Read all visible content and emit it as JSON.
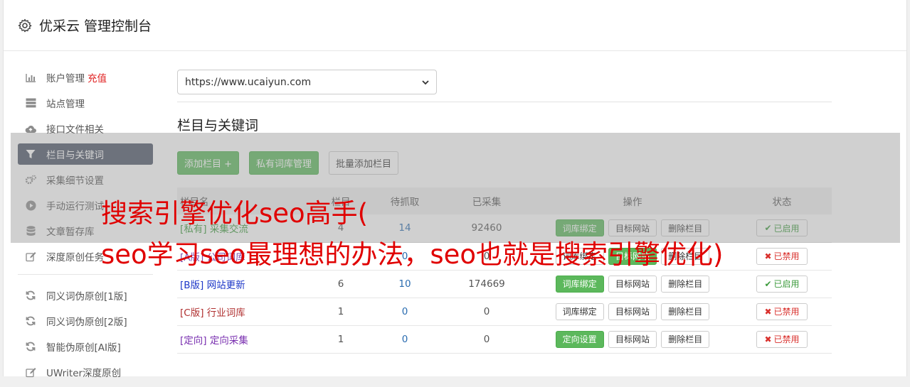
{
  "header": {
    "title": "优采云 管理控制台",
    "icon": "gear-icon"
  },
  "sidebar": {
    "items": [
      {
        "label": "账户管理",
        "extra": "充值",
        "icon": "bar-chart-icon"
      },
      {
        "label": "站点管理",
        "icon": "server-icon"
      },
      {
        "label": "接口文件相关",
        "icon": "cloud-upload-icon"
      },
      {
        "label": "栏目与关键词",
        "icon": "filter-icon",
        "active": true
      },
      {
        "label": "采集细节设置",
        "icon": "cogs-icon"
      },
      {
        "label": "手动运行测试",
        "icon": "play-circle-icon"
      },
      {
        "label": "文章暂存库",
        "icon": "database-icon"
      },
      {
        "label": "深度原创任务",
        "icon": "edit-icon"
      }
    ],
    "items2": [
      {
        "label": "同义词伪原创[1版]",
        "icon": "refresh-icon"
      },
      {
        "label": "同义词伪原创[2版]",
        "icon": "refresh-icon"
      },
      {
        "label": "智能伪原创[AI版]",
        "icon": "refresh-icon"
      },
      {
        "label": "UWriter深度原创",
        "icon": "edit-icon"
      }
    ]
  },
  "site_select": {
    "value": "https://www.ucaiyun.com"
  },
  "section": {
    "title": "栏目与关键词"
  },
  "buttons": {
    "add_column": "添加栏目 +",
    "private_lib": "私有词库管理",
    "batch_add": "批量添加栏目"
  },
  "table": {
    "headers": [
      "栏目名",
      "栏目",
      "待抓取",
      "已采集",
      "操作",
      "状态"
    ],
    "rows": [
      {
        "tag": "[私有]",
        "name": "采集交流",
        "col": "4",
        "pending": "14",
        "collected": "92460",
        "op1": "词库绑定",
        "op2": "目标网站",
        "op3": "删除栏目",
        "status": "已启用",
        "on": true
      },
      {
        "tag": "[A版]",
        "name": "公司词库",
        "col": "",
        "pending": "0",
        "collected": "0",
        "op1": "词库绑定",
        "op2": "目标网站",
        "op3": "删除栏目",
        "status": "已禁用",
        "on": false
      },
      {
        "tag": "[B版]",
        "name": "网站更新",
        "col": "6",
        "pending": "10",
        "collected": "174669",
        "op1": "词库绑定",
        "op2": "目标网站",
        "op3": "删除栏目",
        "status": "已启用",
        "on": true
      },
      {
        "tag": "[C版]",
        "name": "行业词库",
        "col": "1",
        "pending": "0",
        "collected": "0",
        "op1": "词库绑定",
        "op2": "目标网站",
        "op3": "删除栏目",
        "status": "已禁用",
        "on": false
      },
      {
        "tag": "[定向]",
        "name": "定向采集",
        "col": "1",
        "pending": "0",
        "collected": "0",
        "op1": "定向设置",
        "op2": "目标网站",
        "op3": "删除栏目",
        "status": "已禁用",
        "on": false
      }
    ]
  },
  "overlay": {
    "line1": "搜索引擎优化seo高手(",
    "line2": "seo学习seo最理想的办法，seo也就是搜索引擎优化)"
  }
}
